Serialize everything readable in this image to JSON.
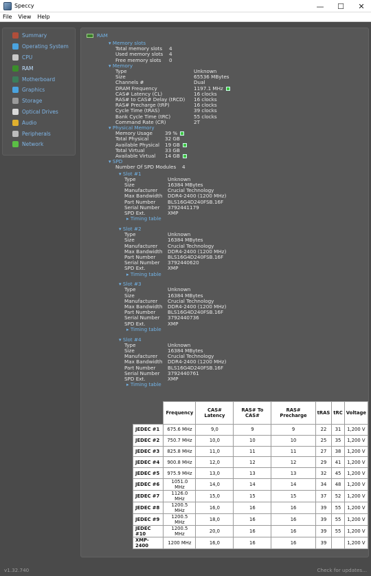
{
  "window": {
    "title": "Speccy",
    "minimize": "—",
    "maximize": "☐",
    "close": "✕"
  },
  "menu": [
    "File",
    "View",
    "Help"
  ],
  "sidebar": [
    {
      "label": "Summary",
      "icon": "summary-icon",
      "color": "#b04e3a"
    },
    {
      "label": "Operating System",
      "icon": "windows-icon",
      "color": "#4aa3df"
    },
    {
      "label": "CPU",
      "icon": "cpu-icon",
      "color": "#c9c9c9"
    },
    {
      "label": "RAM",
      "icon": "ram-icon",
      "color": "#3b8d2b"
    },
    {
      "label": "Motherboard",
      "icon": "motherboard-icon",
      "color": "#3c7d5a"
    },
    {
      "label": "Graphics",
      "icon": "monitor-icon",
      "color": "#4aa3df"
    },
    {
      "label": "Storage",
      "icon": "storage-icon",
      "color": "#9a9a9a"
    },
    {
      "label": "Optical Drives",
      "icon": "disc-icon",
      "color": "#d9d9d9"
    },
    {
      "label": "Audio",
      "icon": "audio-icon",
      "color": "#e0b02e"
    },
    {
      "label": "Peripherals",
      "icon": "peripherals-icon",
      "color": "#bcbcbc"
    },
    {
      "label": "Network",
      "icon": "network-icon",
      "color": "#5bbf45"
    }
  ],
  "ram": {
    "title": "RAM",
    "memory_slots": {
      "header": "Memory slots",
      "rows": [
        {
          "label": "Total memory slots",
          "value": "4"
        },
        {
          "label": "Used memory slots",
          "value": "4"
        },
        {
          "label": "Free memory slots",
          "value": "0"
        }
      ]
    },
    "memory": {
      "header": "Memory",
      "rows": [
        {
          "label": "Type",
          "value": "Unknown"
        },
        {
          "label": "Size",
          "value": "65536 MBytes"
        },
        {
          "label": "Channels #",
          "value": "Dual"
        },
        {
          "label": "DRAM Frequency",
          "value": "1197.1 MHz"
        },
        {
          "label": "CAS# Latency (CL)",
          "value": "16 clocks"
        },
        {
          "label": "RAS# to CAS# Delay (tRCD)",
          "value": "16 clocks"
        },
        {
          "label": "RAS# Precharge (tRP)",
          "value": "16 clocks"
        },
        {
          "label": "Cycle Time (tRAS)",
          "value": "39 clocks"
        },
        {
          "label": "Bank Cycle Time (tRC)",
          "value": "55 clocks"
        },
        {
          "label": "Command Rate (CR)",
          "value": "2T"
        }
      ]
    },
    "physical_memory": {
      "header": "Physical Memory",
      "rows": [
        {
          "label": "Memory Usage",
          "value": "39 %"
        },
        {
          "label": "Total Physical",
          "value": "32 GB"
        },
        {
          "label": "Available Physical",
          "value": "19 GB"
        },
        {
          "label": "Total Virtual",
          "value": "33 GB"
        },
        {
          "label": "Available Virtual",
          "value": "14 GB"
        }
      ]
    },
    "spd": {
      "header": "SPD",
      "modules_label": "Number Of SPD Modules",
      "modules_value": "4",
      "timing_link": "Timing table",
      "slots": [
        {
          "name": "Slot #1",
          "rows": [
            {
              "label": "Type",
              "value": "Unknown"
            },
            {
              "label": "Size",
              "value": "16384 MBytes"
            },
            {
              "label": "Manufacturer",
              "value": "Crucial Technology"
            },
            {
              "label": "Max Bandwidth",
              "value": "DDR4-2400 (1200 MHz)"
            },
            {
              "label": "Part Number",
              "value": "BLS16G4D240FSB.16F"
            },
            {
              "label": "Serial Number",
              "value": "3792441179"
            },
            {
              "label": "SPD Ext.",
              "value": "XMP"
            }
          ]
        },
        {
          "name": "Slot #2",
          "rows": [
            {
              "label": "Type",
              "value": "Unknown"
            },
            {
              "label": "Size",
              "value": "16384 MBytes"
            },
            {
              "label": "Manufacturer",
              "value": "Crucial Technology"
            },
            {
              "label": "Max Bandwidth",
              "value": "DDR4-2400 (1200 MHz)"
            },
            {
              "label": "Part Number",
              "value": "BLS16G4D240FSB.16F"
            },
            {
              "label": "Serial Number",
              "value": "3792440620"
            },
            {
              "label": "SPD Ext.",
              "value": "XMP"
            }
          ]
        },
        {
          "name": "Slot #3",
          "rows": [
            {
              "label": "Type",
              "value": "Unknown"
            },
            {
              "label": "Size",
              "value": "16384 MBytes"
            },
            {
              "label": "Manufacturer",
              "value": "Crucial Technology"
            },
            {
              "label": "Max Bandwidth",
              "value": "DDR4-2400 (1200 MHz)"
            },
            {
              "label": "Part Number",
              "value": "BLS16G4D240FSB.16F"
            },
            {
              "label": "Serial Number",
              "value": "3792440736"
            },
            {
              "label": "SPD Ext.",
              "value": "XMP"
            }
          ]
        },
        {
          "name": "Slot #4",
          "rows": [
            {
              "label": "Type",
              "value": "Unknown"
            },
            {
              "label": "Size",
              "value": "16384 MBytes"
            },
            {
              "label": "Manufacturer",
              "value": "Crucial Technology"
            },
            {
              "label": "Max Bandwidth",
              "value": "DDR4-2400 (1200 MHz)"
            },
            {
              "label": "Part Number",
              "value": "BLS16G4D240FSB.16F"
            },
            {
              "label": "Serial Number",
              "value": "3792440761"
            },
            {
              "label": "SPD Ext.",
              "value": "XMP"
            }
          ]
        }
      ]
    },
    "timing_table": {
      "headers": [
        "Frequency",
        "CAS# Latency",
        "RAS# To CAS#",
        "RAS# Precharge",
        "tRAS",
        "tRC",
        "Voltage"
      ],
      "rows": [
        [
          "JEDEC #1",
          "675.6 MHz",
          "9,0",
          "9",
          "9",
          "22",
          "31",
          "1,200 V"
        ],
        [
          "JEDEC #2",
          "750.7 MHz",
          "10,0",
          "10",
          "10",
          "25",
          "35",
          "1,200 V"
        ],
        [
          "JEDEC #3",
          "825.8 MHz",
          "11,0",
          "11",
          "11",
          "27",
          "38",
          "1,200 V"
        ],
        [
          "JEDEC #4",
          "900.8 MHz",
          "12,0",
          "12",
          "12",
          "29",
          "41",
          "1,200 V"
        ],
        [
          "JEDEC #5",
          "975.9 MHz",
          "13,0",
          "13",
          "13",
          "32",
          "45",
          "1,200 V"
        ],
        [
          "JEDEC #6",
          "1051.0 MHz",
          "14,0",
          "14",
          "14",
          "34",
          "48",
          "1,200 V"
        ],
        [
          "JEDEC #7",
          "1126.0 MHz",
          "15,0",
          "15",
          "15",
          "37",
          "52",
          "1,200 V"
        ],
        [
          "JEDEC #8",
          "1200.5 MHz",
          "16,0",
          "16",
          "16",
          "39",
          "55",
          "1,200 V"
        ],
        [
          "JEDEC #9",
          "1200.5 MHz",
          "18,0",
          "16",
          "16",
          "39",
          "55",
          "1,200 V"
        ],
        [
          "JEDEC #10",
          "1200.5 MHz",
          "20,0",
          "16",
          "16",
          "39",
          "55",
          "1,200 V"
        ],
        [
          "XMP-2400",
          "1200 MHz",
          "16,0",
          "16",
          "16",
          "39",
          "",
          "1,200 V"
        ]
      ]
    }
  },
  "status": {
    "version": "v1.32.740",
    "check_updates": "Check for updates..."
  }
}
